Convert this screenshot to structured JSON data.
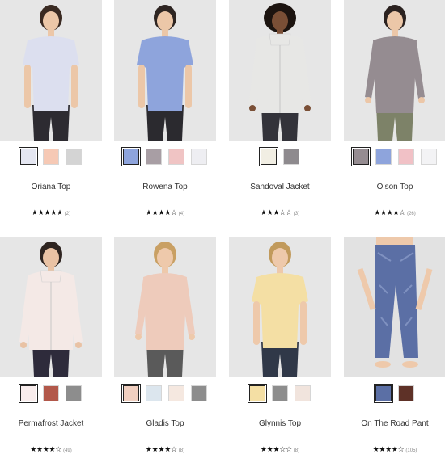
{
  "products": [
    {
      "name": "Oriana Top",
      "count": "(2)",
      "stars": "★★★★★",
      "swatches": [
        {
          "color": "#e4e6f1",
          "selected": true
        },
        {
          "color": "#f6c9b5",
          "selected": false
        },
        {
          "color": "#d4d4d4",
          "selected": false
        }
      ]
    },
    {
      "name": "Rowena Top",
      "count": "(4)",
      "stars": "★★★★☆",
      "swatches": [
        {
          "color": "#8ea4dc",
          "selected": true
        },
        {
          "color": "#a89ea4",
          "selected": false
        },
        {
          "color": "#f0c4c4",
          "selected": false
        },
        {
          "color": "#eeeef2",
          "selected": false
        }
      ]
    },
    {
      "name": "Sandoval Jacket",
      "count": "(3)",
      "stars": "★★★☆☆",
      "swatches": [
        {
          "color": "#f1eee3",
          "selected": true
        },
        {
          "color": "#8e8a8e",
          "selected": false
        }
      ]
    },
    {
      "name": "Olson Top",
      "count": "(26)",
      "stars": "★★★★☆",
      "swatches": [
        {
          "color": "#958c91",
          "selected": true
        },
        {
          "color": "#8ea4dc",
          "selected": false
        },
        {
          "color": "#f1c1c6",
          "selected": false
        },
        {
          "color": "#f3f3f5",
          "selected": false
        }
      ]
    },
    {
      "name": "Permafrost Jacket",
      "count": "(49)",
      "stars": "★★★★☆",
      "swatches": [
        {
          "color": "#f8ecec",
          "selected": true
        },
        {
          "color": "#b2584a",
          "selected": false
        },
        {
          "color": "#8d8d8d",
          "selected": false
        }
      ]
    },
    {
      "name": "Gladis Top",
      "count": "(8)",
      "stars": "★★★★☆",
      "swatches": [
        {
          "color": "#f0cfc0",
          "selected": true
        },
        {
          "color": "#dce6ee",
          "selected": false
        },
        {
          "color": "#f5e8e0",
          "selected": false
        },
        {
          "color": "#8d8d8d",
          "selected": false
        }
      ]
    },
    {
      "name": "Glynnis Top",
      "count": "(8)",
      "stars": "★★★☆☆",
      "swatches": [
        {
          "color": "#f4dfa4",
          "selected": true
        },
        {
          "color": "#8d8d8d",
          "selected": false
        },
        {
          "color": "#f1e4dd",
          "selected": false
        }
      ]
    },
    {
      "name": "On The Road Pant",
      "count": "(105)",
      "stars": "★★★★☆",
      "swatches": [
        {
          "color": "#5b6fa5",
          "selected": true
        },
        {
          "color": "#5e3127",
          "selected": false
        }
      ]
    }
  ],
  "photos": [
    {
      "bg": "#e6e6e6",
      "skin": "#ecc7a8",
      "hair": "#3a2a22",
      "top": "#dcdfef",
      "bottom": "#2d2b31",
      "type": "tee"
    },
    {
      "bg": "#e6e6e6",
      "skin": "#ecc7a8",
      "hair": "#2e2522",
      "top": "#8ea4dc",
      "bottom": "#2b2a2f",
      "type": "tee"
    },
    {
      "bg": "#e6e6e6",
      "skin": "#7a4f36",
      "hair": "#1c1410",
      "top": "#e7e7e5",
      "bottom": "#33333a",
      "type": "jacket"
    },
    {
      "bg": "#e6e6e6",
      "skin": "#ecc7a8",
      "hair": "#2b2220",
      "top": "#958c91",
      "bottom": "#7d8268",
      "type": "long"
    },
    {
      "bg": "#e6e6e6",
      "skin": "#e9c2a4",
      "hair": "#2e2420",
      "top": "#f4e9e6",
      "bottom": "#2e2b3b",
      "type": "jacket"
    },
    {
      "bg": "#e6e6e6",
      "skin": "#eec9ab",
      "hair": "#c9a064",
      "top": "#eecbbb",
      "bottom": "#5a5a5a",
      "type": "long"
    },
    {
      "bg": "#e6e6e6",
      "skin": "#eec9ab",
      "hair": "#c19a5c",
      "top": "#f4dfa4",
      "bottom": "#303848",
      "type": "tee"
    },
    {
      "bg": "#e2e2e2",
      "skin": "#eec9ab",
      "hair": "#6e5040",
      "top": "#5b6fa5",
      "bottom": "#5b6fa5",
      "type": "pant"
    }
  ]
}
